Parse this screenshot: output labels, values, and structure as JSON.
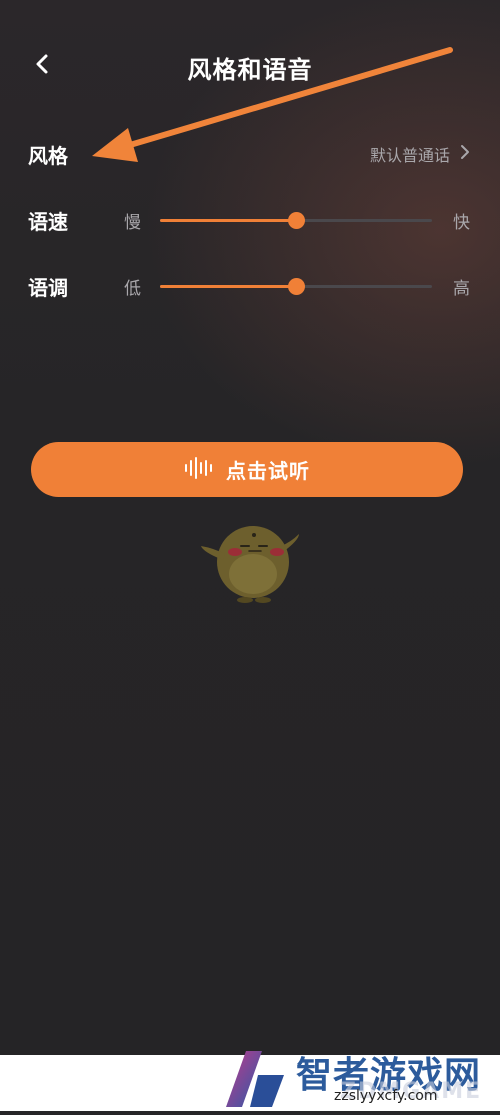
{
  "header": {
    "title": "风格和语音"
  },
  "style": {
    "label": "风格",
    "value": "默认普通话"
  },
  "speed": {
    "label": "语速",
    "min_label": "慢",
    "max_label": "快",
    "value": 0.5
  },
  "tone": {
    "label": "语调",
    "min_label": "低",
    "max_label": "高",
    "value": 0.5
  },
  "listen_button": {
    "label": "点击试听"
  },
  "icons": {
    "back": "back-chevron-icon",
    "style_more": "chevron-right-icon",
    "listen": "sound-wave-icon",
    "mascot": "bird-mascot-icon"
  },
  "colors": {
    "accent": "#f08037",
    "background": "#262527",
    "annotation": "#f0843a"
  },
  "watermark": {
    "title": "智者游戏网",
    "subtitle": "ZDMGAME",
    "url": "zzslyyxcfy.com"
  }
}
